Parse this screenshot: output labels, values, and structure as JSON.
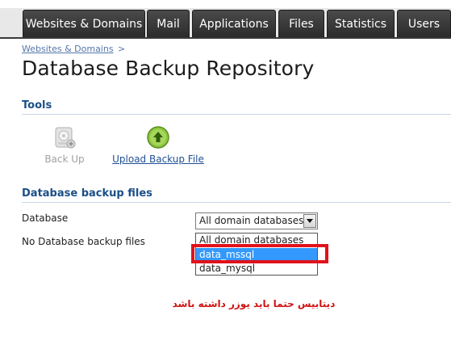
{
  "tabs": [
    {
      "label": "Websites & Domains"
    },
    {
      "label": "Mail"
    },
    {
      "label": "Applications"
    },
    {
      "label": "Files"
    },
    {
      "label": "Statistics"
    },
    {
      "label": "Users"
    }
  ],
  "breadcrumb": {
    "link": "Websites & Domains",
    "separator": ">"
  },
  "page_title": "Database Backup Repository",
  "tools": {
    "heading": "Tools",
    "back_up_label": "Back Up",
    "upload_label": "Upload Backup File",
    "back_up_icon": "disk-backup-icon",
    "upload_icon": "upload-arrow-icon"
  },
  "backups": {
    "heading": "Database backup files",
    "database_label": "Database",
    "empty_text": "No Database backup files",
    "select_value": "All domain databases",
    "options": [
      "All domain databases",
      "data_mssql",
      "data_mysql"
    ],
    "selected_option": "data_mssql"
  },
  "annotation": {
    "text": "دیتابیس حتما باید یوزر داشته باشد",
    "color": "#d01212"
  },
  "colors": {
    "accent": "#1a4f86",
    "tab_bg": "#2b2b2b",
    "selected": "#3399ff",
    "highlight": "#e0121b"
  }
}
